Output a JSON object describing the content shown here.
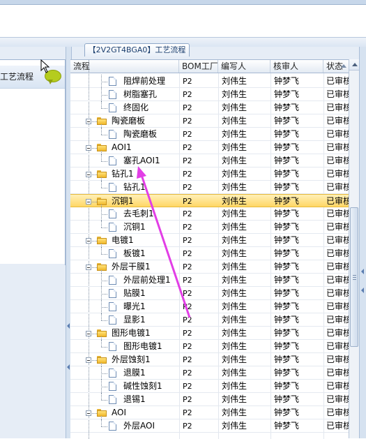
{
  "tab": {
    "label": "【2V2GT4BGA0】工艺流程"
  },
  "left_panel": {
    "item_label": "工艺流程"
  },
  "columns": {
    "flow": "流程",
    "bom": "BOM工厂",
    "writer": "编写人",
    "reviewer": "核审人",
    "status": "状态"
  },
  "rows": [
    {
      "name": "阻焊前处理",
      "bom": "P2",
      "writer": "刘伟生",
      "reviewer": "钟梦飞",
      "status": "已审核"
    },
    {
      "name": "树脂塞孔",
      "bom": "P2",
      "writer": "刘伟生",
      "reviewer": "钟梦飞",
      "status": "已审核"
    },
    {
      "name": "终固化",
      "bom": "P2",
      "writer": "刘伟生",
      "reviewer": "钟梦飞",
      "status": "已审核"
    },
    {
      "name": "陶瓷磨板",
      "bom": "P2",
      "writer": "刘伟生",
      "reviewer": "钟梦飞",
      "status": "已审核"
    },
    {
      "name": "陶瓷磨板",
      "bom": "P2",
      "writer": "刘伟生",
      "reviewer": "钟梦飞",
      "status": "已审核"
    },
    {
      "name": "AOI1",
      "bom": "P2",
      "writer": "刘伟生",
      "reviewer": "钟梦飞",
      "status": "已审核"
    },
    {
      "name": "塞孔AOI1",
      "bom": "P2",
      "writer": "刘伟生",
      "reviewer": "钟梦飞",
      "status": "已审核"
    },
    {
      "name": "钻孔1",
      "bom": "P2",
      "writer": "刘伟生",
      "reviewer": "钟梦飞",
      "status": "已审核"
    },
    {
      "name": "钻孔1",
      "bom": "P2",
      "writer": "刘伟生",
      "reviewer": "钟梦飞",
      "status": "已审核"
    },
    {
      "name": "沉铜1",
      "bom": "P2",
      "writer": "刘伟生",
      "reviewer": "钟梦飞",
      "status": "已审核"
    },
    {
      "name": "去毛刺1",
      "bom": "P2",
      "writer": "刘伟生",
      "reviewer": "钟梦飞",
      "status": "已审核"
    },
    {
      "name": "沉铜1",
      "bom": "P2",
      "writer": "刘伟生",
      "reviewer": "钟梦飞",
      "status": "已审核"
    },
    {
      "name": "电镀1",
      "bom": "P2",
      "writer": "刘伟生",
      "reviewer": "钟梦飞",
      "status": "已审核"
    },
    {
      "name": "板镀1",
      "bom": "P2",
      "writer": "刘伟生",
      "reviewer": "钟梦飞",
      "status": "已审核"
    },
    {
      "name": "外层干膜1",
      "bom": "P2",
      "writer": "刘伟生",
      "reviewer": "钟梦飞",
      "status": "已审核"
    },
    {
      "name": "外层前处理1",
      "bom": "P2",
      "writer": "刘伟生",
      "reviewer": "钟梦飞",
      "status": "已审核"
    },
    {
      "name": "贴膜1",
      "bom": "P2",
      "writer": "刘伟生",
      "reviewer": "钟梦飞",
      "status": "已审核"
    },
    {
      "name": "曝光1",
      "bom": "P2",
      "writer": "刘伟生",
      "reviewer": "钟梦飞",
      "status": "已审核"
    },
    {
      "name": "显影1",
      "bom": "P2",
      "writer": "刘伟生",
      "reviewer": "钟梦飞",
      "status": "已审核"
    },
    {
      "name": "图形电镀1",
      "bom": "P2",
      "writer": "刘伟生",
      "reviewer": "钟梦飞",
      "status": "已审核"
    },
    {
      "name": "图形电镀1",
      "bom": "P2",
      "writer": "刘伟生",
      "reviewer": "钟梦飞",
      "status": "已审核"
    },
    {
      "name": "外层蚀刻1",
      "bom": "P2",
      "writer": "刘伟生",
      "reviewer": "钟梦飞",
      "status": "已审核"
    },
    {
      "name": "退膜1",
      "bom": "P2",
      "writer": "刘伟生",
      "reviewer": "钟梦飞",
      "status": "已审核"
    },
    {
      "name": "碱性蚀刻1",
      "bom": "P2",
      "writer": "刘伟生",
      "reviewer": "钟梦飞",
      "status": "已审核"
    },
    {
      "name": "退锡1",
      "bom": "P2",
      "writer": "刘伟生",
      "reviewer": "钟梦飞",
      "status": "已审核"
    },
    {
      "name": "AOI",
      "bom": "P2",
      "writer": "刘伟生",
      "reviewer": "钟梦飞",
      "status": "已审核"
    },
    {
      "name": "外层AOI",
      "bom": "P2",
      "writer": "刘伟生",
      "reviewer": "钟梦飞",
      "status": "已审核"
    }
  ],
  "colors": {
    "selection": "#ffd766",
    "annotation_arrow": "#e23ee6"
  }
}
